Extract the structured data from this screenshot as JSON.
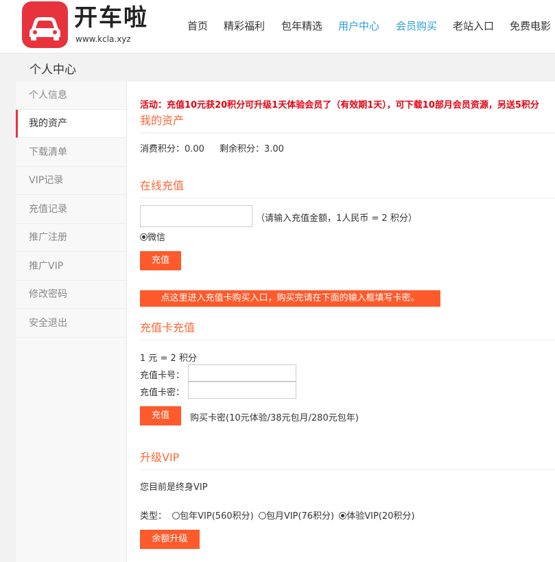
{
  "brand": {
    "name": "开车啦",
    "url": "www.kcla.xyz",
    "color": "#e8333d"
  },
  "nav": [
    {
      "label": "首页"
    },
    {
      "label": "精彩福利"
    },
    {
      "label": "包年精选"
    },
    {
      "label": "用户中心"
    },
    {
      "label": "会员购买"
    },
    {
      "label": "老站入口"
    },
    {
      "label": "免费电影"
    }
  ],
  "page_title": "个人中心",
  "sidebar": [
    {
      "label": "个人信息"
    },
    {
      "label": "我的资产"
    },
    {
      "label": "下载清单"
    },
    {
      "label": "VIP记录"
    },
    {
      "label": "充值记录"
    },
    {
      "label": "推广注册"
    },
    {
      "label": "推广VIP"
    },
    {
      "label": "修改密码"
    },
    {
      "label": "安全退出"
    }
  ],
  "notice": "活动：充值10元获20积分可升级1天体验会员了（有效期1天），可下载10部月会员资源，另送5积分",
  "assets": {
    "title": "我的资产",
    "spent": "消费积分：0.00",
    "remaining": "剩余积分：3.00"
  },
  "online_recharge": {
    "title": "在线充值",
    "amount_value": "",
    "hint": "（请输入充值金额，1人民币 = 2 积分）",
    "pay_method": "微信",
    "submit": "充值",
    "card_entry": "点这里进入充值卡购买入口，购买完请在下面的输入框填写卡密。"
  },
  "card_recharge": {
    "title": "充值卡充值",
    "rate": "1 元 = 2 积分",
    "card_no_label": "充值卡号：",
    "card_pwd_label": "充值卡密：",
    "submit": "充值",
    "buy_text": "购买卡密(10元体验/38元包月/280元包年)"
  },
  "upgrade": {
    "title": "升级VIP",
    "status": "您目前是终身VIP",
    "type_label": "类型：",
    "options": [
      {
        "label": "包年VIP(560积分)"
      },
      {
        "label": "包月VIP(76积分)"
      },
      {
        "label": "体验VIP(20积分)"
      }
    ],
    "selected": "体验VIP(20积分)",
    "submit": "余额升级"
  },
  "colors": {
    "accent": "#ff5a2c",
    "section_title": "#ff6633",
    "notice": "#e6000f",
    "nav_active": "#2a9fd6"
  }
}
